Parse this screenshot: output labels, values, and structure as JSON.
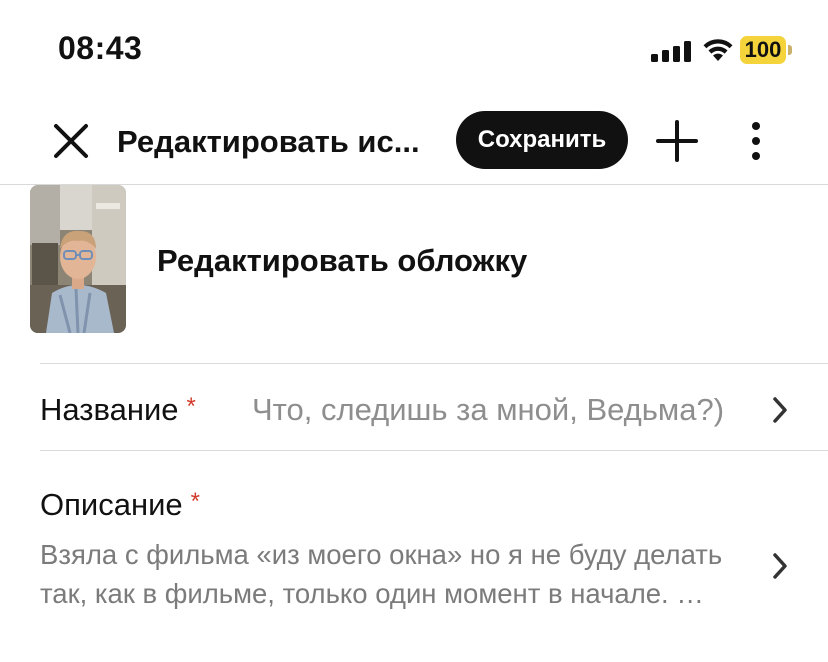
{
  "status_bar": {
    "time": "08:43",
    "battery": "100",
    "battery_color": "#f5d33b",
    "signal_icon": "cellular-signal-icon",
    "wifi_icon": "wifi-icon"
  },
  "toolbar": {
    "close_icon": "close-icon",
    "title": "Редактировать ис...",
    "save_label": "Сохранить",
    "add_icon": "plus-icon",
    "more_icon": "more-vertical-icon"
  },
  "cover": {
    "label": "Редактировать обложку"
  },
  "fields": {
    "title": {
      "label": "Название",
      "required_mark": "*",
      "value": "Что, следишь за мной, Ведьма?)"
    },
    "description": {
      "label": "Описание",
      "required_mark": "*",
      "value": "Взяла с фильма «из моего окна» но я не буду делать так, как в фильме, только один момент в начале. …"
    }
  },
  "colors": {
    "accent": "#111111",
    "required": "#d23b2b",
    "muted_text": "#8e8e8e"
  }
}
